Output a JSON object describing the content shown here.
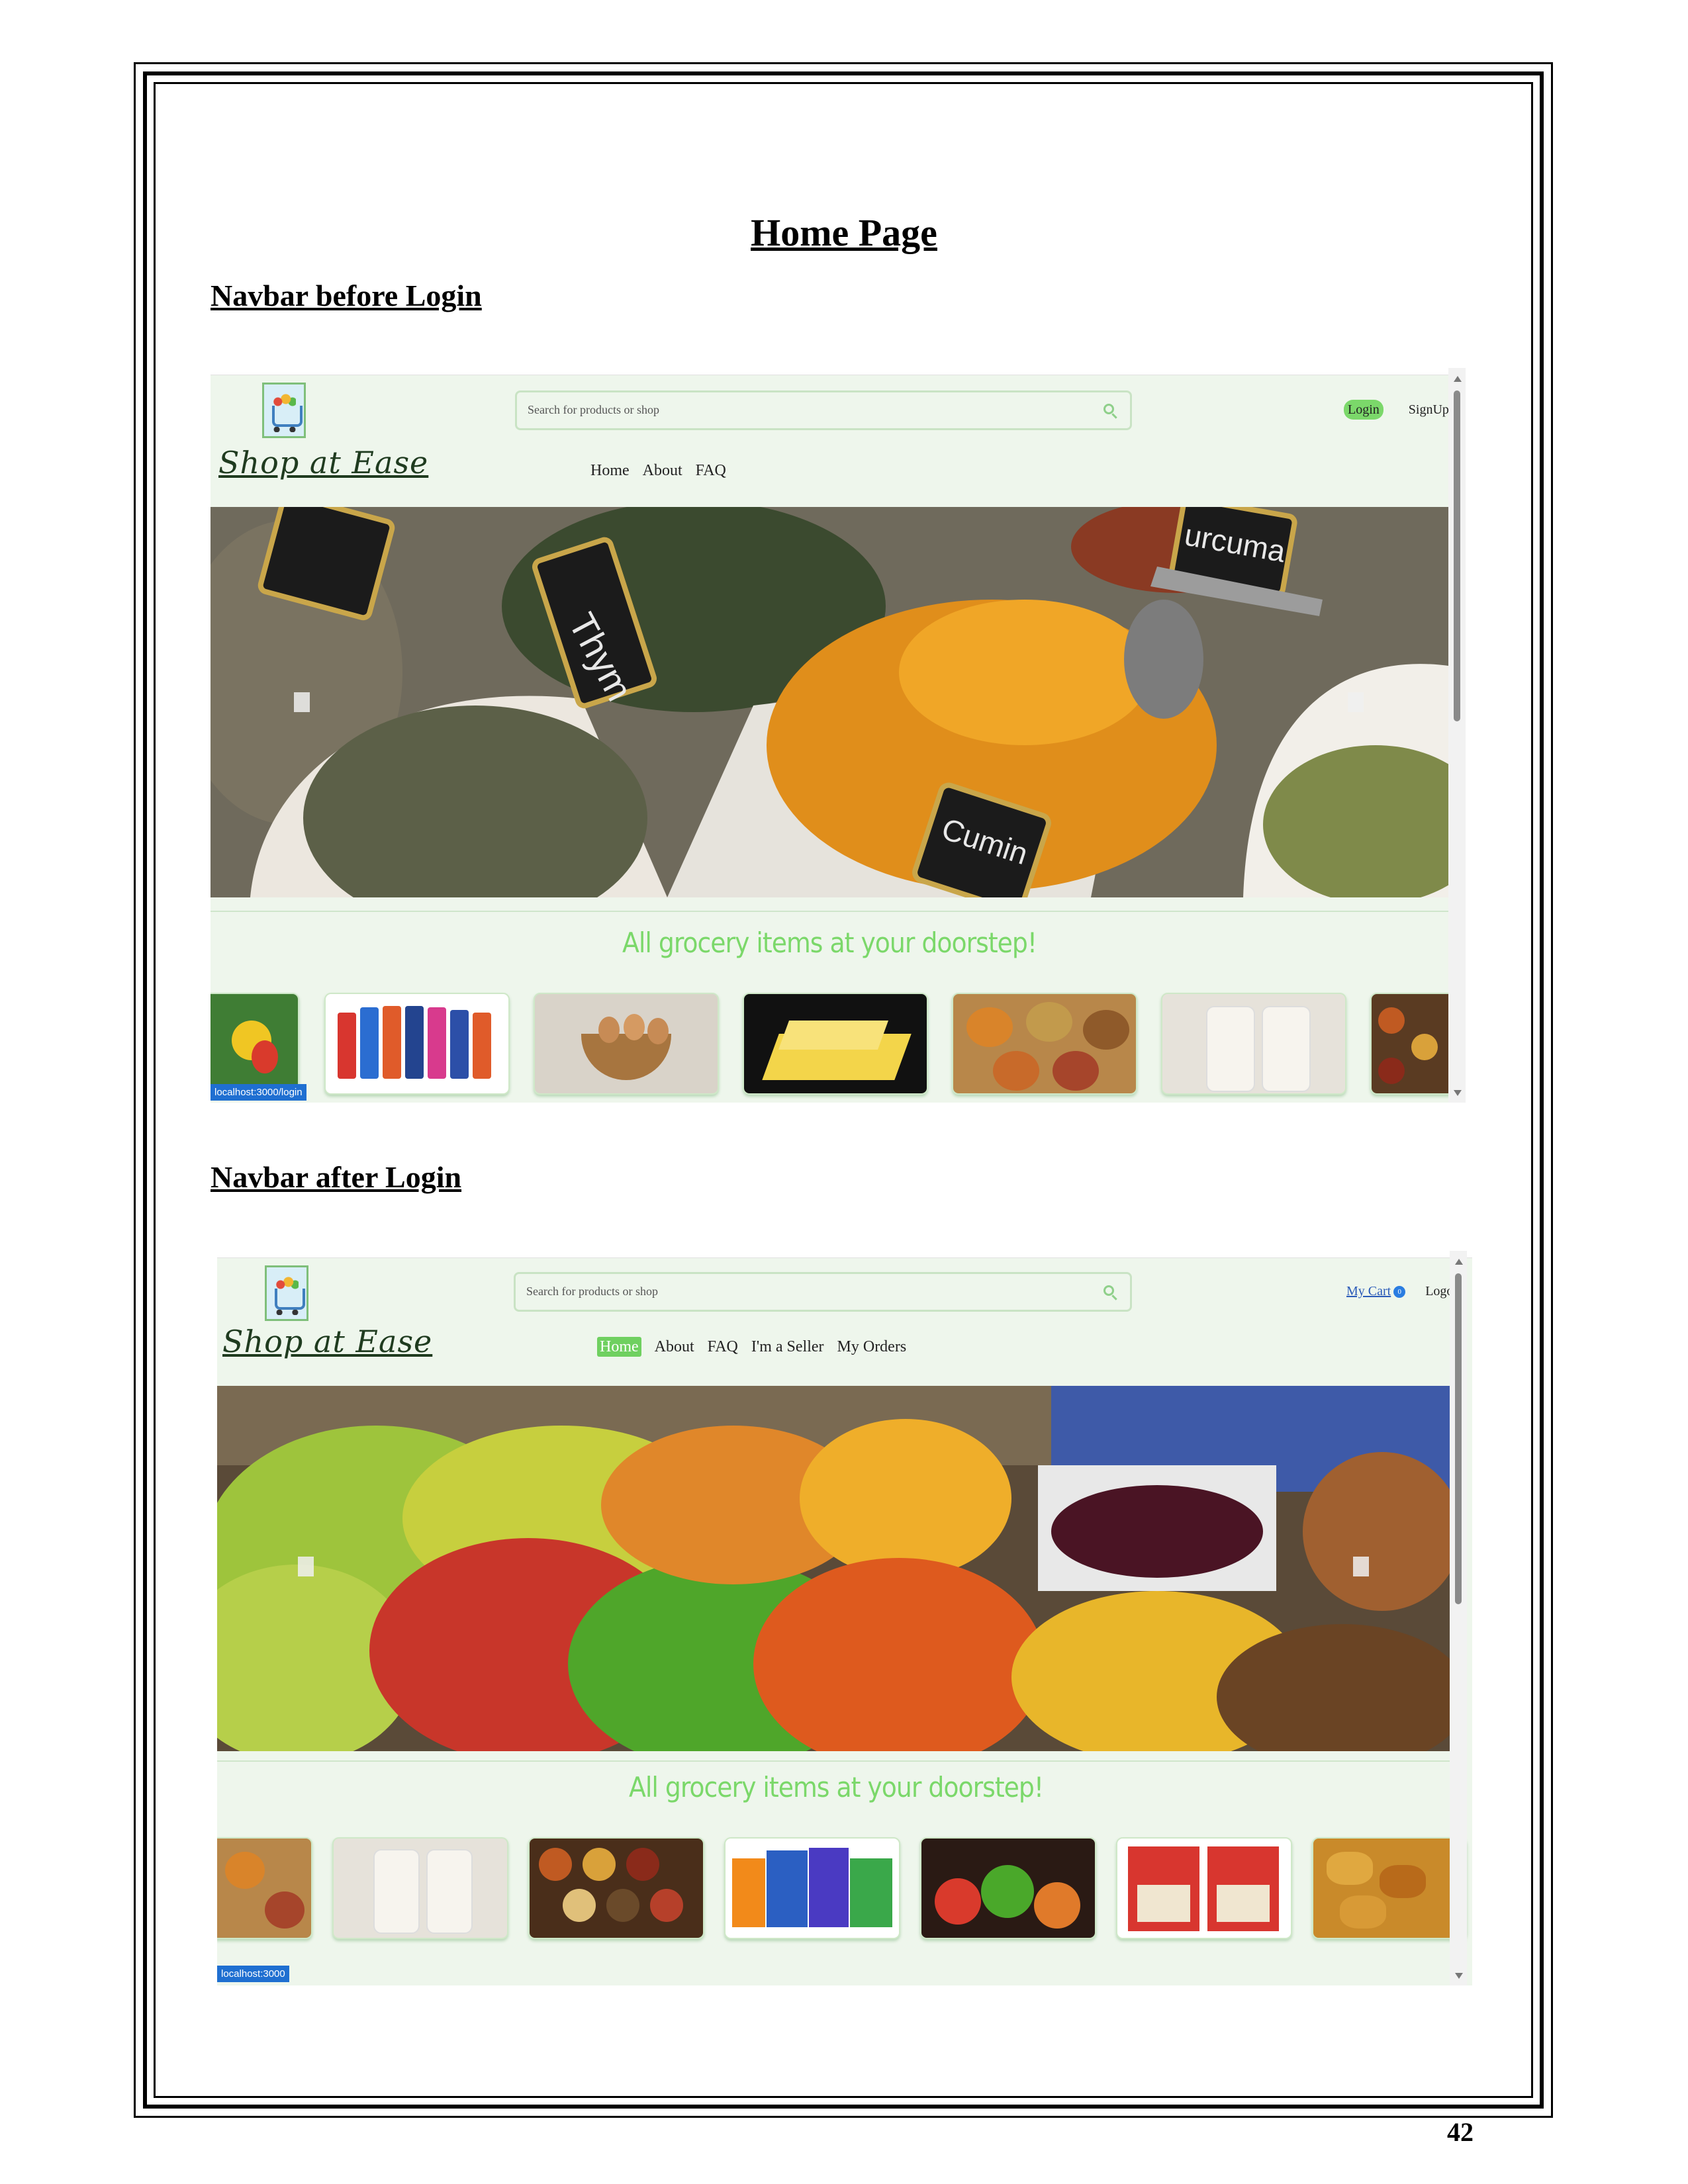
{
  "page": {
    "title": "Home Page",
    "page_number": "42"
  },
  "sections": [
    {
      "heading": "Navbar before Login",
      "screenshot": {
        "logo_text": "Shop at Ease",
        "search_placeholder": "Search for products or shop",
        "nav_items": [
          "Home",
          "About",
          "FAQ"
        ],
        "auth_links": [
          "Login",
          "SignUp"
        ],
        "tagline": "All grocery items at your doorstep!",
        "status_url": "localhost:3000/login"
      }
    },
    {
      "heading": "Navbar after Login",
      "screenshot": {
        "logo_text": "Shop at Ease",
        "search_placeholder": "Search for products or shop",
        "nav_items": [
          "Home",
          "About",
          "FAQ",
          "I'm a Seller",
          "My Orders"
        ],
        "active_nav": "Home",
        "cart_link": "My Cart",
        "cart_count": "0",
        "logout_link": "Logout",
        "tagline": "All grocery items at your doorstep!",
        "status_url": "localhost:3000"
      }
    }
  ],
  "colors": {
    "accent_green": "#7bd86a",
    "app_background": "#eef6ec",
    "link_blue": "#2a5ab8"
  }
}
